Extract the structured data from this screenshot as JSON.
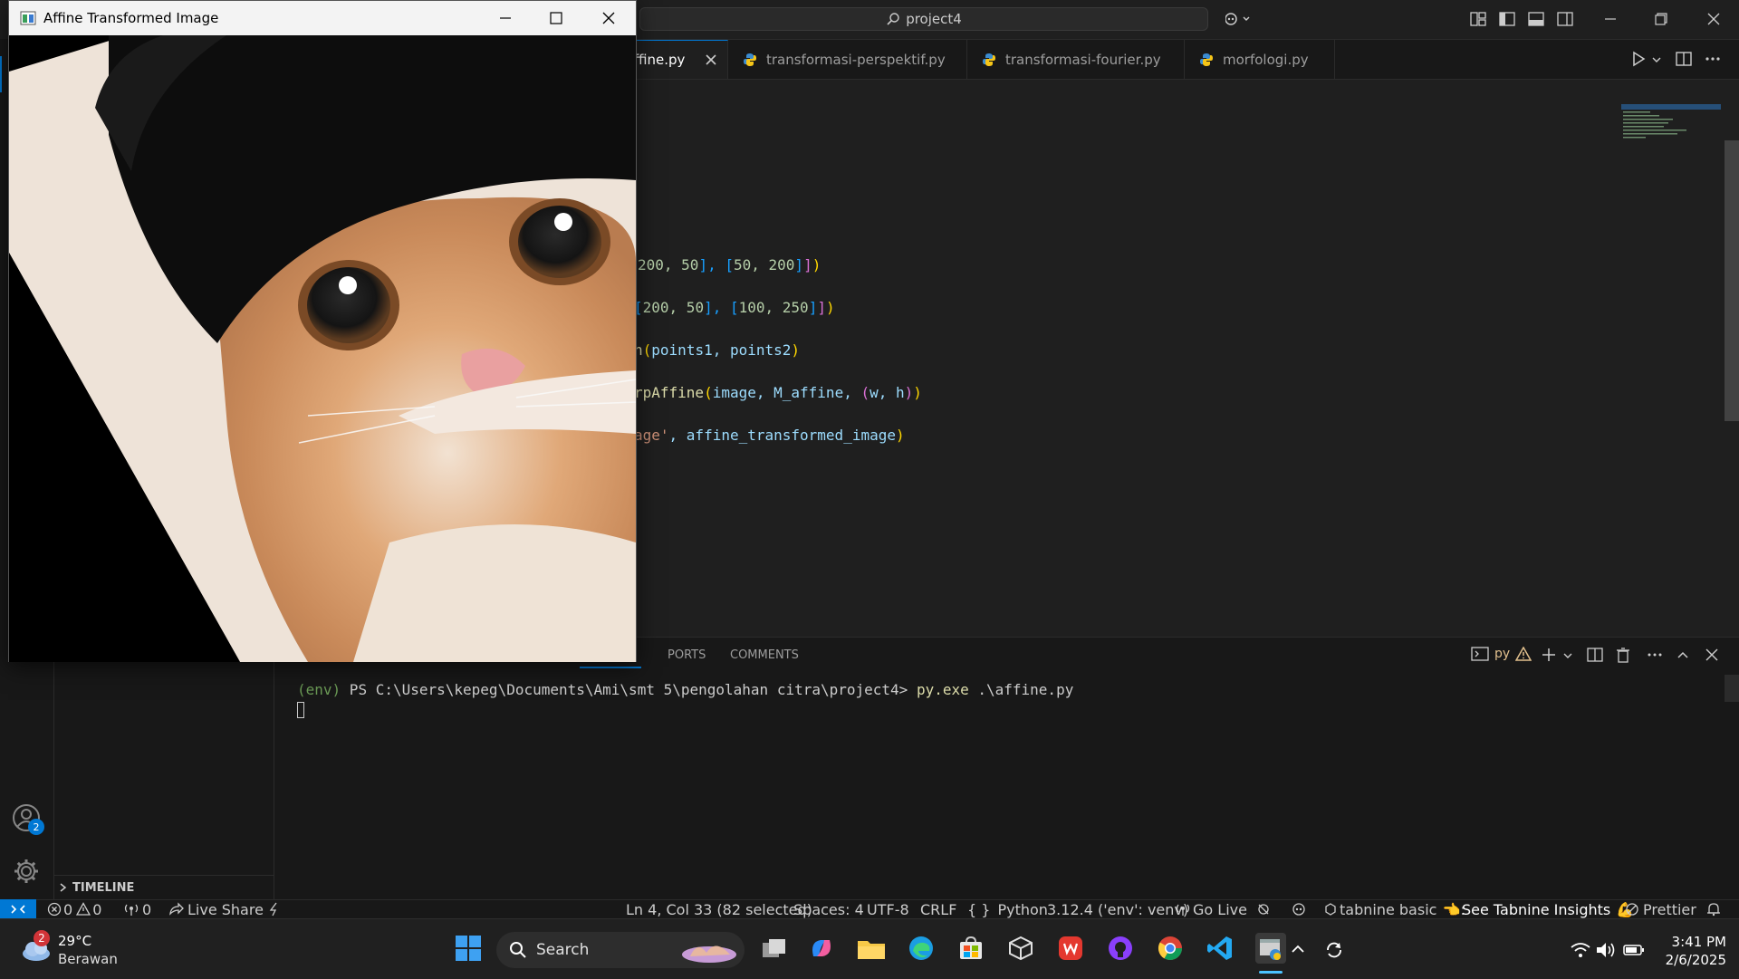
{
  "titlebar": {
    "search_label": "project4"
  },
  "tabs": [
    {
      "label": "affine.py",
      "visible_label": "ffine.py",
      "active": true
    },
    {
      "label": "transformasi-perspektif.py"
    },
    {
      "label": "transformasi-fourier.py"
    },
    {
      "label": "morfologi.py"
    }
  ],
  "code_lines": [
    {
      "seg": [
        {
          "t": "200, 50",
          "c": "num"
        },
        {
          "t": "], ",
          "c": "br3"
        },
        {
          "t": "[",
          "c": "br3"
        },
        {
          "t": "50, 200",
          "c": "num"
        },
        {
          "t": "]",
          "c": "br3"
        },
        {
          "t": "]",
          "c": "br2"
        },
        {
          "t": ")",
          "c": "br"
        }
      ]
    },
    {
      "seg": [
        {
          "t": "[",
          "c": "br3"
        },
        {
          "t": "200, 50",
          "c": "num"
        },
        {
          "t": "], ",
          "c": "br3"
        },
        {
          "t": "[",
          "c": "br3"
        },
        {
          "t": "100, 250",
          "c": "num"
        },
        {
          "t": "]",
          "c": "br3"
        },
        {
          "t": "]",
          "c": "br2"
        },
        {
          "t": ")",
          "c": "br"
        }
      ]
    },
    {
      "seg": [
        {
          "t": "n",
          "c": "fn"
        },
        {
          "t": "(",
          "c": "br"
        },
        {
          "t": "points1, points2",
          "c": "blue"
        },
        {
          "t": ")",
          "c": "br"
        }
      ]
    },
    {
      "seg": [
        {
          "t": "rpAffine",
          "c": "fn"
        },
        {
          "t": "(",
          "c": "br"
        },
        {
          "t": "image, M_affine, ",
          "c": "blue"
        },
        {
          "t": "(",
          "c": "br2"
        },
        {
          "t": "w, h",
          "c": "blue"
        },
        {
          "t": ")",
          "c": "br2"
        },
        {
          "t": ")",
          "c": "br"
        }
      ]
    },
    {
      "seg": [
        {
          "t": "age'",
          "c": "str"
        },
        {
          "t": ", affine_transformed_image",
          "c": "blue"
        },
        {
          "t": ")",
          "c": "br"
        }
      ]
    }
  ],
  "panel": {
    "tabs": [
      "PORTS",
      "COMMENTS"
    ],
    "terminal_name": "py",
    "terminal_env": "(env)",
    "terminal_prompt": " PS C:\\Users\\kepeg\\Documents\\Ami\\smt 5\\pengolahan citra\\project4> ",
    "terminal_cmd": "py.exe",
    "terminal_arg": " .\\affine.py"
  },
  "sidebar": {
    "timeline_label": "TIMELINE",
    "accounts_badge": "2"
  },
  "statusbar": {
    "errors": "0",
    "warnings": "0",
    "ports": "0",
    "live_share": "Live Share",
    "position": "Ln 4, Col 33 (82 selected)",
    "spaces": "Spaces: 4",
    "encoding": "UTF-8",
    "eol": "CRLF",
    "language": "Python",
    "interpreter": "3.12.4 ('env': venv)",
    "go_live": "Go Live",
    "tabnine": "tabnine basic",
    "tabnine_insights": "See Tabnine Insights",
    "prettier": "Prettier"
  },
  "image_window": {
    "title": "Affine Transformed Image"
  },
  "taskbar": {
    "weather_temp": "29°C",
    "weather_desc": "Berawan",
    "weather_badge": "2",
    "search_label": "Search",
    "time": "3:41 PM",
    "date": "2/6/2025"
  }
}
